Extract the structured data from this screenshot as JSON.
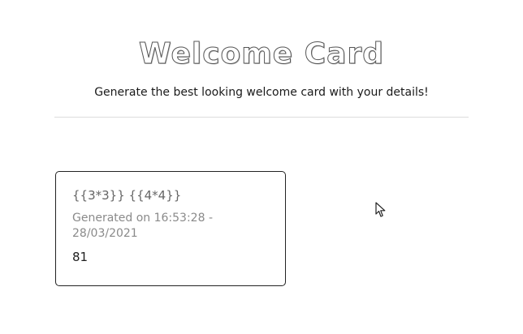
{
  "header": {
    "title": "Welcome Card",
    "subtitle": "Generate the best looking welcome card with your details!"
  },
  "card": {
    "heading": "{{3*3}} {{4*4}}",
    "generated": "Generated on 16:53:28 - 28/03/2021",
    "value": "81"
  },
  "icons": {
    "cursor": "mouse-pointer-icon"
  }
}
